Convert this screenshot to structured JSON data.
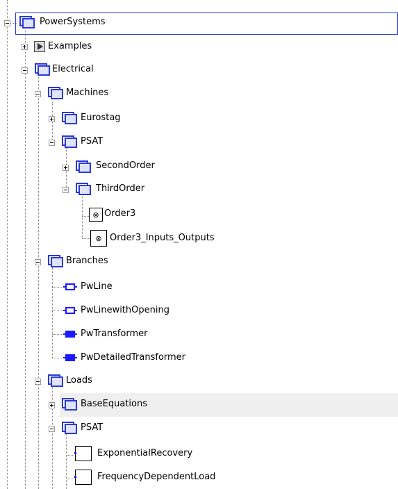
{
  "tree": {
    "root": "PowerSystems",
    "examples": "Examples",
    "electrical": "Electrical",
    "machines": "Machines",
    "eurostag": "Eurostag",
    "psat_machines": "PSAT",
    "second_order": "SecondOrder",
    "third_order": "ThirdOrder",
    "order3": "Order3",
    "order3_io": "Order3_Inputs_Outputs",
    "branches": "Branches",
    "pwline": "PwLine",
    "pwline_opening": "PwLinewithOpening",
    "pwtransformer": "PwTransformer",
    "pwdetailed": "PwDetailedTransformer",
    "loads": "Loads",
    "base_equations": "BaseEquations",
    "psat_loads": "PSAT",
    "exp_recovery": "ExponentialRecovery",
    "freq_dep_load": "FrequencyDependentLoad"
  },
  "colors": {
    "accent": "#2a3ad6",
    "selection_border": "#2a3ad6",
    "hover_bg": "#efefef"
  }
}
